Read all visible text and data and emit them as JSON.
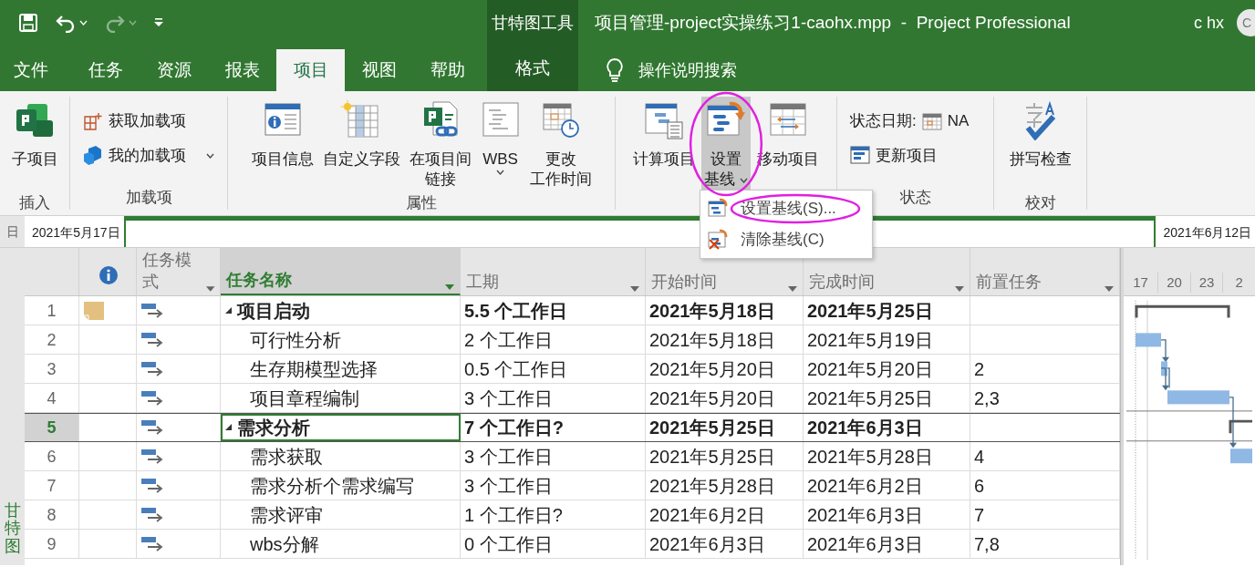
{
  "quick_access": [
    {
      "kind": "save",
      "disabled": false
    },
    {
      "kind": "undo",
      "disabled": false
    },
    {
      "kind": "redo",
      "disabled": true
    },
    {
      "kind": "customize",
      "disabled": false
    }
  ],
  "contextual_header": "甘特图工具",
  "window": {
    "title": "项目管理-project实操练习1-caohx.mpp  -  Project Professional"
  },
  "user": {
    "name": "c hx",
    "initials": "C"
  },
  "tabs": [
    {
      "label": "文件",
      "selected": false,
      "contextual": false
    },
    {
      "label": "任务",
      "selected": false,
      "contextual": false
    },
    {
      "label": "资源",
      "selected": false,
      "contextual": false
    },
    {
      "label": "报表",
      "selected": false,
      "contextual": false
    },
    {
      "label": "项目",
      "selected": true,
      "contextual": false
    },
    {
      "label": "视图",
      "selected": false,
      "contextual": false
    },
    {
      "label": "帮助",
      "selected": false,
      "contextual": false
    },
    {
      "label": "格式",
      "selected": false,
      "contextual": true
    }
  ],
  "tell_me": "操作说明搜索",
  "ribbon": {
    "groups": [
      {
        "label": "插入",
        "controls": [
          {
            "kind": "large",
            "lines": [
              "子项目"
            ]
          }
        ]
      },
      {
        "label": "加载项",
        "controls": [
          {
            "kind": "small",
            "label": "获取加载项"
          },
          {
            "kind": "small",
            "label": "我的加载项",
            "dropdown": true
          }
        ]
      },
      {
        "label": "属性",
        "controls": [
          {
            "kind": "large",
            "lines": [
              "项目信息"
            ]
          },
          {
            "kind": "large",
            "lines": [
              "自定义字段"
            ]
          },
          {
            "kind": "large",
            "lines": [
              "在项目间",
              "链接"
            ]
          },
          {
            "kind": "large",
            "lines": [
              "WBS"
            ],
            "dropdown": true
          },
          {
            "kind": "large",
            "lines": [
              "更改",
              "工作时间"
            ]
          }
        ]
      },
      {
        "controls": [
          {
            "kind": "large",
            "lines": [
              "计算项目"
            ]
          },
          {
            "kind": "large",
            "lines": [
              "设置",
              "基线"
            ],
            "dropdown": true,
            "pressed": true,
            "highlighted": true
          },
          {
            "kind": "large",
            "lines": [
              "移动项目"
            ]
          }
        ]
      },
      {
        "label": "状态",
        "controls": [
          {
            "kind": "field",
            "label": "状态日期:",
            "value": "NA"
          },
          {
            "kind": "small",
            "label": "更新项目"
          }
        ]
      },
      {
        "label": "校对",
        "controls": [
          {
            "kind": "large",
            "lines": [
              "拼写检查"
            ]
          }
        ]
      }
    ]
  },
  "dropdown_menu": {
    "items": [
      {
        "label": "设置基线(S)...",
        "highlighted": true
      },
      {
        "label": "清除基线(C)",
        "highlighted": false
      }
    ]
  },
  "timeline": {
    "label": "日",
    "start": "2021年5月17日",
    "end": "2021年6月12日"
  },
  "view_bar": {
    "label": "甘特图"
  },
  "table": {
    "columns": [
      {
        "kind": "indicator"
      },
      {
        "kind": "text",
        "label": "任务模式",
        "selected": false
      },
      {
        "kind": "text",
        "label": "任务名称",
        "selected": true
      },
      {
        "kind": "text",
        "label": "工期",
        "selected": false
      },
      {
        "kind": "text",
        "label": "开始时间",
        "selected": false
      },
      {
        "kind": "text",
        "label": "完成时间",
        "selected": false
      },
      {
        "kind": "text",
        "label": "前置任务",
        "selected": false
      }
    ],
    "rows": [
      {
        "id": "1",
        "note": true,
        "summary": true,
        "selected": false,
        "name": "项目启动",
        "duration": "5.5 个工作日",
        "start": "2021年5月18日",
        "finish": "2021年5月25日"
      },
      {
        "id": "2",
        "note": false,
        "summary": false,
        "selected": false,
        "name": "可行性分析",
        "duration": "2 个工作日",
        "start": "2021年5月18日",
        "finish": "2021年5月19日"
      },
      {
        "id": "3",
        "note": false,
        "summary": false,
        "selected": false,
        "name": "生存期模型选择",
        "duration": "0.5 个工作日",
        "start": "2021年5月20日",
        "finish": "2021年5月20日",
        "predecessors": "2"
      },
      {
        "id": "4",
        "note": false,
        "summary": false,
        "selected": false,
        "name": "项目章程编制",
        "duration": "3 个工作日",
        "start": "2021年5月20日",
        "finish": "2021年5月25日",
        "predecessors": "2,3"
      },
      {
        "id": "5",
        "note": false,
        "summary": true,
        "selected": true,
        "name": "需求分析",
        "duration": "7 个工作日?",
        "start": "2021年5月25日",
        "finish": "2021年6月3日"
      },
      {
        "id": "6",
        "note": false,
        "summary": false,
        "selected": false,
        "name": "需求获取",
        "duration": "3 个工作日",
        "start": "2021年5月25日",
        "finish": "2021年5月28日",
        "predecessors": "4"
      },
      {
        "id": "7",
        "note": false,
        "summary": false,
        "selected": false,
        "name": "需求分析个需求编写",
        "duration": "3 个工作日",
        "start": "2021年5月28日",
        "finish": "2021年6月2日",
        "predecessors": "6"
      },
      {
        "id": "8",
        "note": false,
        "summary": false,
        "selected": false,
        "name": "需求评审",
        "duration": "1 个工作日?",
        "start": "2021年6月2日",
        "finish": "2021年6月3日",
        "predecessors": "7"
      },
      {
        "id": "9",
        "note": false,
        "summary": false,
        "selected": false,
        "name": "wbs分解",
        "duration": "0 个工作日",
        "start": "2021年6月3日",
        "finish": "2021年6月3日",
        "predecessors": "7,8"
      }
    ]
  },
  "gantt": {
    "timescale": [
      "17",
      "20",
      "23",
      "2"
    ]
  }
}
